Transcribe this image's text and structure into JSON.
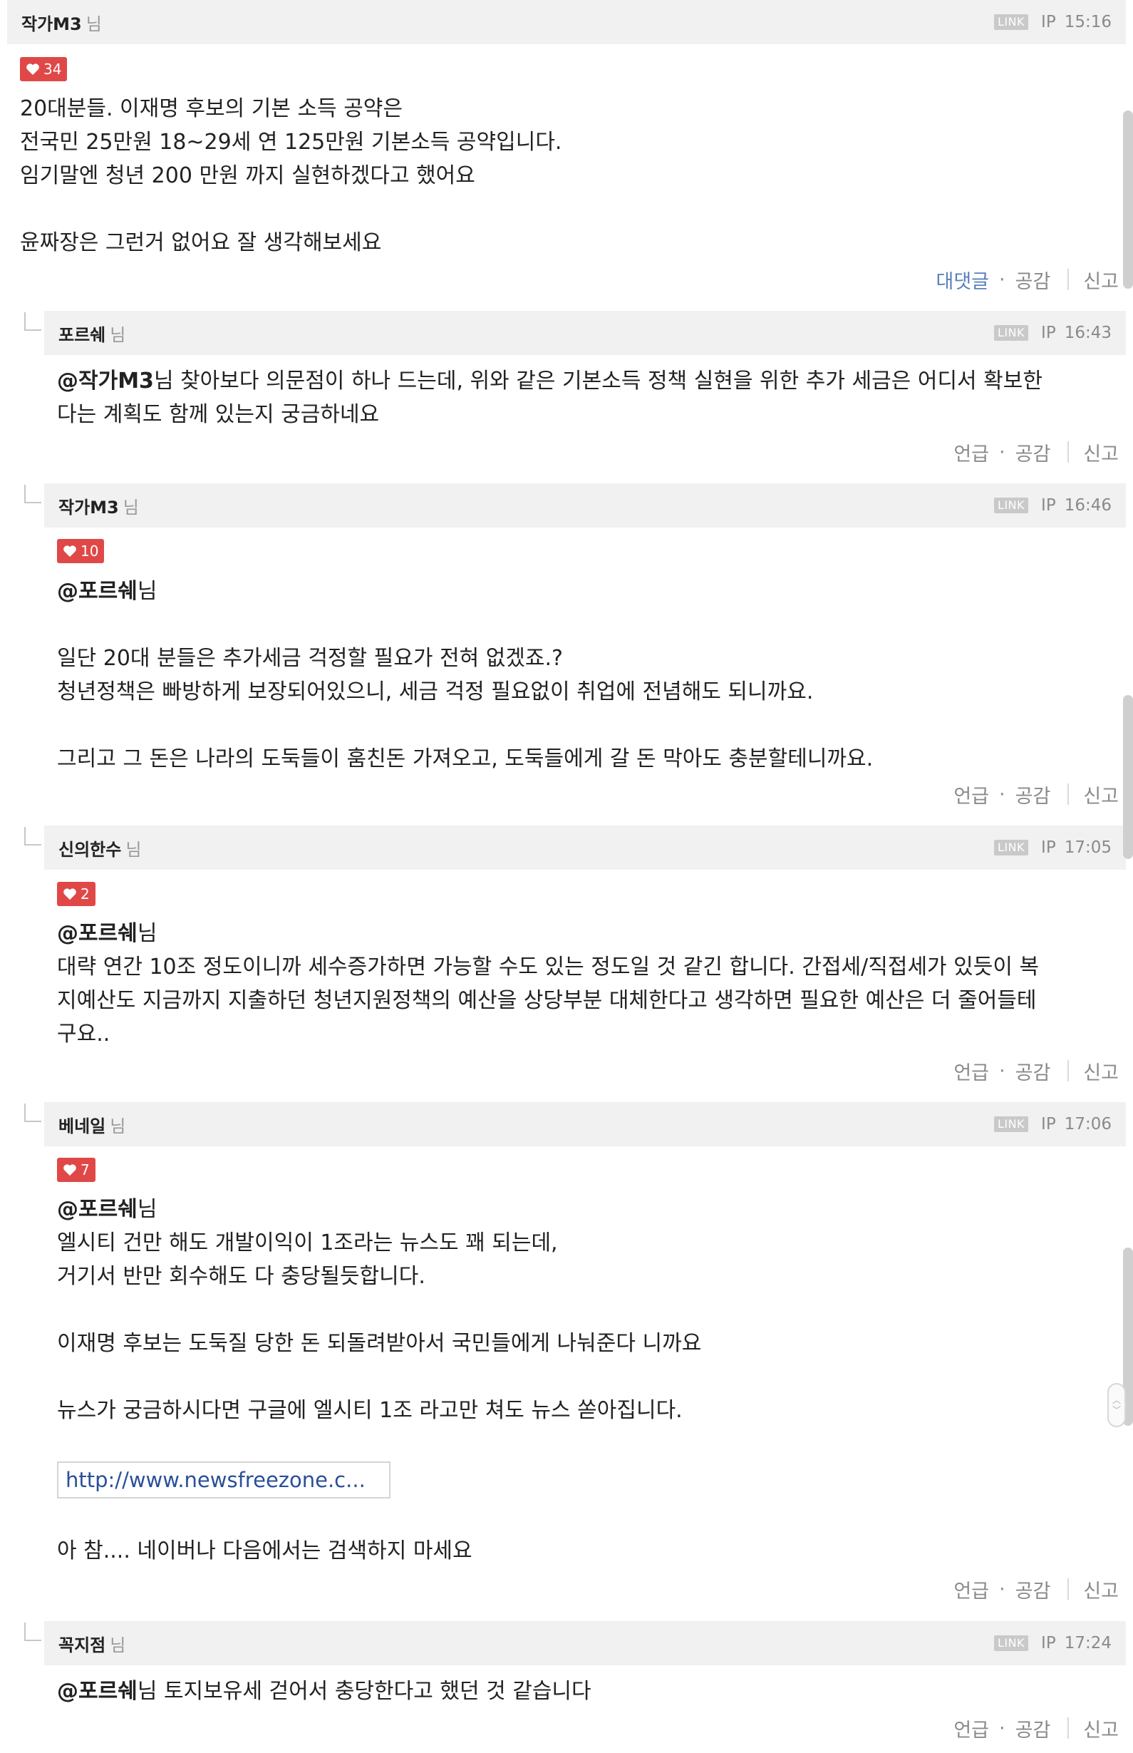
{
  "comments": [
    {
      "author": "작가M3",
      "suffix": "님",
      "link_label": "LINK",
      "ip_label": "IP",
      "time": "15:16",
      "likes": "34",
      "lines": [
        "20대분들. 이재명 후보의 기본 소득 공약은",
        "전국민 25만원 18~29세 연 125만원 기본소득 공약입니다.",
        "임기말엔 청년 200 만원 까지 실현하겠다고 했어요",
        "",
        "윤짜장은 그런거 없어요 잘 생각해보세요"
      ],
      "actions": {
        "primary": "대댓글",
        "like": "공감",
        "report": "신고"
      }
    },
    {
      "author": "포르쉐",
      "suffix": "님",
      "link_label": "LINK",
      "ip_label": "IP",
      "time": "16:43",
      "mention": "@작가M3",
      "lines": [
        "님 찾아보다 의문점이 하나 드는데, 위와 같은 기본소득 정책 실현을 위한 추가 세금은 어디서 확보한",
        "다는 계획도 함께 있는지 궁금하네요"
      ],
      "actions": {
        "primary": "언급",
        "like": "공감",
        "report": "신고"
      }
    },
    {
      "author": "작가M3",
      "suffix": "님",
      "link_label": "LINK",
      "ip_label": "IP",
      "time": "16:46",
      "likes": "10",
      "mention": "@포르쉐",
      "lines": [
        "님",
        "",
        "일단 20대 분들은 추가세금 걱정할 필요가 전혀 없겠죠.?",
        "청년정책은 빠방하게 보장되어있으니, 세금 걱정 필요없이 취업에 전념해도 되니까요.",
        "",
        "그리고 그 돈은 나라의 도둑들이 훔친돈 가져오고, 도둑들에게 갈 돈 막아도 충분할테니까요."
      ],
      "actions": {
        "primary": "언급",
        "like": "공감",
        "report": "신고"
      }
    },
    {
      "author": "신의한수",
      "suffix": "님",
      "link_label": "LINK",
      "ip_label": "IP",
      "time": "17:05",
      "likes": "2",
      "mention": "@포르쉐",
      "lines": [
        "님",
        "대략 연간 10조 정도이니까 세수증가하면 가능할 수도 있는 정도일 것 같긴 합니다. 간접세/직접세가 있듯이 복",
        "지예산도 지금까지 지출하던 청년지원정책의 예산을 상당부분 대체한다고 생각하면 필요한 예산은 더 줄어들테",
        "구요.."
      ],
      "actions": {
        "primary": "언급",
        "like": "공감",
        "report": "신고"
      }
    },
    {
      "author": "베네일",
      "suffix": "님",
      "link_label": "LINK",
      "ip_label": "IP",
      "time": "17:06",
      "likes": "7",
      "mention": "@포르쉐",
      "lines": [
        "님",
        "엘시티 건만 해도 개발이익이 1조라는 뉴스도 꽤 되는데,",
        "거기서 반만 회수해도 다 충당될듯합니다.",
        "",
        "이재명 후보는 도둑질 당한 돈 되돌려받아서 국민들에게 나눠준다 니까요",
        "",
        "뉴스가 궁금하시다면 구글에 엘시티 1조 라고만 쳐도 뉴스 쏟아집니다."
      ],
      "link_preview": "http://www.newsfreezone.c...",
      "after_link": "아 참.... 네이버나 다음에서는 검색하지 마세요",
      "actions": {
        "primary": "언급",
        "like": "공감",
        "report": "신고"
      }
    },
    {
      "author": "꼭지점",
      "suffix": "님",
      "link_label": "LINK",
      "ip_label": "IP",
      "time": "17:24",
      "mention": "@포르쉐",
      "lines": [
        "님 토지보유세 걷어서 충당한다고 했던 것 같습니다"
      ],
      "actions": {
        "primary": "언급",
        "like": "공감",
        "report": "신고"
      }
    }
  ]
}
